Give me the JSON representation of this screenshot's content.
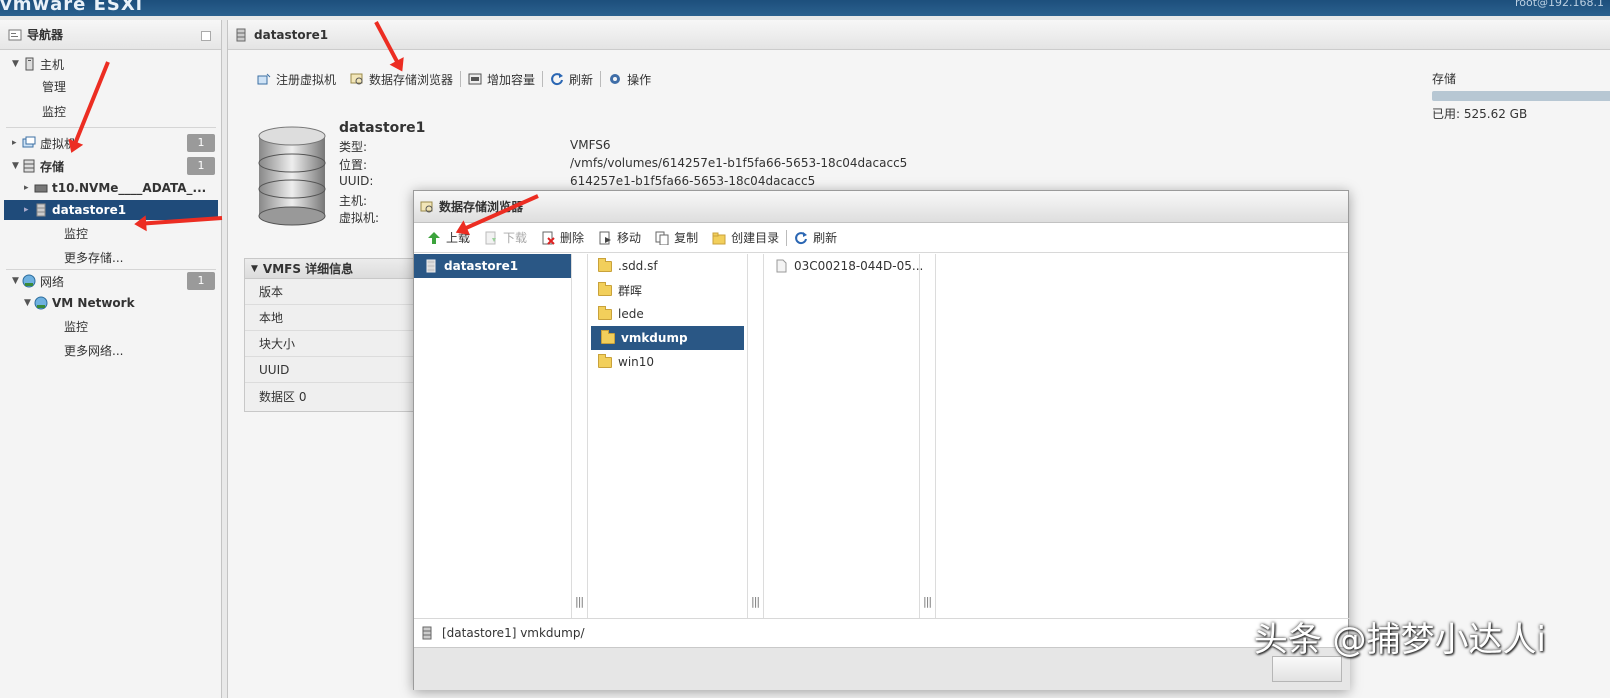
{
  "topbar": {
    "brand": "vmware ESXi",
    "user": "root@192.168.1"
  },
  "navigator": {
    "title": "导航器",
    "host": {
      "label": "主机",
      "items": [
        "管理",
        "监控"
      ]
    },
    "vms": {
      "label": "虚拟机",
      "count": "1"
    },
    "storage": {
      "label": "存储",
      "count": "1",
      "devices": [
        "t10.NVMe____ADATA_...",
        "datastore1"
      ],
      "sub_items": [
        "监控",
        "更多存储..."
      ]
    },
    "network": {
      "label": "网络",
      "count": "1",
      "device": "VM Network",
      "sub_items": [
        "监控",
        "更多网络..."
      ]
    }
  },
  "main": {
    "title": "datastore1",
    "toolbar": [
      "注册虚拟机",
      "数据存储浏览器",
      "增加容量",
      "刷新",
      "操作"
    ],
    "details": {
      "name": "datastore1",
      "rows": [
        {
          "key": "类型:",
          "value": "VMFS6"
        },
        {
          "key": "位置:",
          "value": "/vmfs/volumes/614257e1-b1f5fa66-5653-18c04dacacc5"
        },
        {
          "key": "UUID:",
          "value": "614257e1-b1f5fa66-5653-18c04dacacc5"
        },
        {
          "key": "主机:",
          "value": ""
        },
        {
          "key": "虚拟机:",
          "value": ""
        }
      ]
    },
    "storage_side": {
      "label": "存储",
      "used": "已用: 525.62 GB"
    },
    "vmfs_panel": {
      "title": "VMFS 详细信息",
      "rows": [
        "版本",
        "本地",
        "块大小",
        "UUID",
        "数据区 0"
      ]
    }
  },
  "browser_dialog": {
    "title": "数据存储浏览器",
    "toolbar": {
      "upload": "上载",
      "download": "下载",
      "delete": "删除",
      "move": "移动",
      "copy": "复制",
      "mkdir": "创建目录",
      "refresh": "刷新"
    },
    "col1": [
      "datastore1"
    ],
    "col2": [
      ".sdd.sf",
      "群晖",
      "lede",
      "vmkdump",
      "win10"
    ],
    "col3": [
      "03C00218-044D-05..."
    ],
    "selected_folder": "vmkdump",
    "path": "[datastore1] vmkdump/"
  },
  "watermark": "头条 @捕梦小达人i",
  "colors": {
    "selection": "#1f4b7a",
    "arrow": "#ec2d22"
  }
}
